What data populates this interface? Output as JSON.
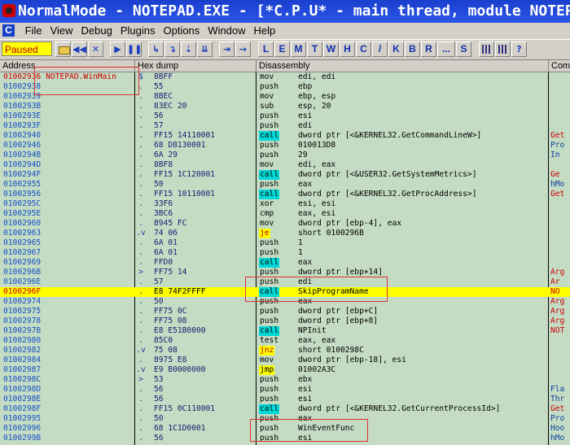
{
  "window": {
    "title": "NormalMode - NOTEPAD.EXE - [*C.P.U* - main thread, module NOTEPAD]"
  },
  "menu": {
    "cpu_badge": "C",
    "items": [
      "File",
      "View",
      "Debug",
      "Plugins",
      "Options",
      "Window",
      "Help"
    ]
  },
  "toolbar": {
    "status": "Paused",
    "buttons": [
      {
        "icon": "open-folder-icon",
        "glyph": ""
      },
      {
        "icon": "rewind-icon",
        "glyph": "◀◀"
      },
      {
        "icon": "close-icon",
        "glyph": "✕"
      },
      {
        "icon": "run-icon",
        "glyph": "▶"
      },
      {
        "icon": "pause-icon",
        "glyph": "❚❚"
      },
      {
        "icon": "step-into-icon",
        "glyph": "↳"
      },
      {
        "icon": "step-over-icon",
        "glyph": "↴"
      },
      {
        "icon": "trace-into-icon",
        "glyph": "⇣"
      },
      {
        "icon": "trace-over-icon",
        "glyph": "⇊"
      },
      {
        "icon": "execute-till-return-icon",
        "glyph": "⇥"
      },
      {
        "icon": "go-to-icon",
        "glyph": "→"
      }
    ],
    "window_buttons": [
      "L",
      "E",
      "M",
      "T",
      "W",
      "H",
      "C",
      "/",
      "K",
      "B",
      "R",
      "...",
      "S"
    ]
  },
  "columns": {
    "address": "Address",
    "hex": "Hex dump",
    "disasm": "Disassembly",
    "comment": "Comm"
  },
  "rows": [
    {
      "addr": "01002936",
      "label": "NOTEPAD.WinMain",
      "mark": "$",
      "hex": "8BFF",
      "mn": "mov",
      "op": "edi, edi",
      "cm": ""
    },
    {
      "addr": "01002938",
      "label": "",
      "mark": ".",
      "hex": "55",
      "mn": "push",
      "op": "ebp",
      "cm": ""
    },
    {
      "addr": "01002939",
      "label": "",
      "mark": ".",
      "hex": "8BEC",
      "mn": "mov",
      "op": "ebp, esp",
      "cm": ""
    },
    {
      "addr": "0100293B",
      "label": "",
      "mark": ".",
      "hex": "83EC 20",
      "mn": "sub",
      "op": "esp, 20",
      "cm": ""
    },
    {
      "addr": "0100293E",
      "label": "",
      "mark": ".",
      "hex": "56",
      "mn": "push",
      "op": "esi",
      "cm": ""
    },
    {
      "addr": "0100293F",
      "label": "",
      "mark": ".",
      "hex": "57",
      "mn": "push",
      "op": "edi",
      "cm": ""
    },
    {
      "addr": "01002940",
      "label": "",
      "mark": ".",
      "hex": "FF15 14110001",
      "mn": "call",
      "op": "dword ptr [<&KERNEL32.GetCommandLineW>]",
      "cm": "Get"
    },
    {
      "addr": "01002946",
      "label": "",
      "mark": ".",
      "hex": "68 D8130001",
      "mn": "push",
      "op": "010013D8",
      "cm": "Pro"
    },
    {
      "addr": "0100294B",
      "label": "",
      "mark": ".",
      "hex": "6A 29",
      "mn": "push",
      "op": "29",
      "cm": "In"
    },
    {
      "addr": "0100294D",
      "label": "",
      "mark": ".",
      "hex": "8BF8",
      "mn": "mov",
      "op": "edi, eax",
      "cm": ""
    },
    {
      "addr": "0100294F",
      "label": "",
      "mark": ".",
      "hex": "FF15 1C120001",
      "mn": "call",
      "op": "dword ptr [<&USER32.GetSystemMetrics>]",
      "cm": "Ge"
    },
    {
      "addr": "01002955",
      "label": "",
      "mark": ".",
      "hex": "50",
      "mn": "push",
      "op": "eax",
      "cm": "hMo"
    },
    {
      "addr": "01002956",
      "label": "",
      "mark": ".",
      "hex": "FF15 10110001",
      "mn": "call",
      "op": "dword ptr [<&KERNEL32.GetProcAddress>]",
      "cm": "Get"
    },
    {
      "addr": "0100295C",
      "label": "",
      "mark": ".",
      "hex": "33F6",
      "mn": "xor",
      "op": "esi, esi",
      "cm": ""
    },
    {
      "addr": "0100295E",
      "label": "",
      "mark": ".",
      "hex": "3BC6",
      "mn": "cmp",
      "op": "eax, esi",
      "cm": ""
    },
    {
      "addr": "01002960",
      "label": "",
      "mark": ".",
      "hex": "8945 FC",
      "mn": "mov",
      "op": "dword ptr [ebp-4], eax",
      "cm": ""
    },
    {
      "addr": "01002963",
      "label": "",
      "mark": ".v",
      "hex": "74 06",
      "mn": "je",
      "op": "short 0100296B",
      "cm": ""
    },
    {
      "addr": "01002965",
      "label": "",
      "mark": ".",
      "hex": "6A 01",
      "mn": "push",
      "op": "1",
      "cm": ""
    },
    {
      "addr": "01002967",
      "label": "",
      "mark": ".",
      "hex": "6A 01",
      "mn": "push",
      "op": "1",
      "cm": ""
    },
    {
      "addr": "01002969",
      "label": "",
      "mark": ".",
      "hex": "FFD0",
      "mn": "call",
      "op": "eax",
      "cm": ""
    },
    {
      "addr": "0100296B",
      "label": "",
      "mark": ">",
      "hex": "FF75 14",
      "mn": "push",
      "op": "dword ptr [ebp+14]",
      "cm": "Arg"
    },
    {
      "addr": "0100296E",
      "label": "",
      "mark": ".",
      "hex": "57",
      "mn": "push",
      "op": "edi",
      "cm": "Ar"
    },
    {
      "addr": "0100296F",
      "label": "",
      "mark": ".",
      "hex": "E8 74F2FFFF",
      "mn": "call",
      "op": "SkipProgramName",
      "cm": "NO"
    },
    {
      "addr": "01002974",
      "label": "",
      "mark": ".",
      "hex": "50",
      "mn": "push",
      "op": "eax",
      "cm": "Arg"
    },
    {
      "addr": "01002975",
      "label": "",
      "mark": ".",
      "hex": "FF75 0C",
      "mn": "push",
      "op": "dword ptr [ebp+C]",
      "cm": "Arg"
    },
    {
      "addr": "01002978",
      "label": "",
      "mark": ".",
      "hex": "FF75 08",
      "mn": "push",
      "op": "dword ptr [ebp+8]",
      "cm": "Arg"
    },
    {
      "addr": "0100297B",
      "label": "",
      "mark": ".",
      "hex": "E8 E51B0000",
      "mn": "call",
      "op": "NPInit",
      "cm": "NOT"
    },
    {
      "addr": "01002980",
      "label": "",
      "mark": ".",
      "hex": "85C0",
      "mn": "test",
      "op": "eax, eax",
      "cm": ""
    },
    {
      "addr": "01002982",
      "label": "",
      "mark": ".v",
      "hex": "75 08",
      "mn": "jnz",
      "op": "short 0100298C",
      "cm": ""
    },
    {
      "addr": "01002984",
      "label": "",
      "mark": ".",
      "hex": "8975 E8",
      "mn": "mov",
      "op": "dword ptr [ebp-18], esi",
      "cm": ""
    },
    {
      "addr": "01002987",
      "label": "",
      "mark": ".v",
      "hex": "E9 B0000000",
      "mn": "jmp",
      "op": "01002A3C",
      "cm": ""
    },
    {
      "addr": "0100298C",
      "label": "",
      "mark": ">",
      "hex": "53",
      "mn": "push",
      "op": "ebx",
      "cm": ""
    },
    {
      "addr": "0100298D",
      "label": "",
      "mark": ".",
      "hex": "56",
      "mn": "push",
      "op": "esi",
      "cm": "Fla"
    },
    {
      "addr": "0100298E",
      "label": "",
      "mark": ".",
      "hex": "56",
      "mn": "push",
      "op": "esi",
      "cm": "Thr"
    },
    {
      "addr": "0100298F",
      "label": "",
      "mark": ".",
      "hex": "FF15 0C110001",
      "mn": "call",
      "op": "dword ptr [<&KERNEL32.GetCurrentProcessId>]",
      "cm": "Get"
    },
    {
      "addr": "01002995",
      "label": "",
      "mark": ".",
      "hex": "50",
      "mn": "push",
      "op": "eax",
      "cm": "Pro"
    },
    {
      "addr": "01002996",
      "label": "",
      "mark": ".",
      "hex": "68 1C1D0001",
      "mn": "push",
      "op": "WinEventFunc",
      "cm": "Hoo"
    },
    {
      "addr": "0100299B",
      "label": "",
      "mark": ".",
      "hex": "56",
      "mn": "push",
      "op": "esi",
      "cm": "hMo"
    }
  ],
  "highlight_row": "0100296F"
}
